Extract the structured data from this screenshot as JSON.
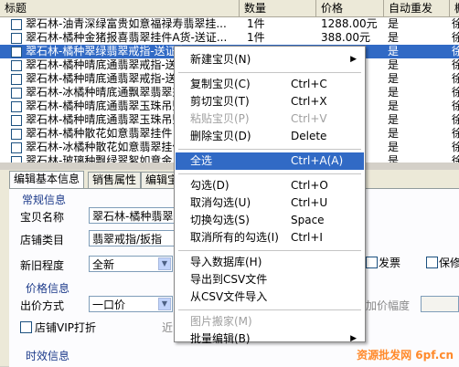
{
  "table": {
    "columns": [
      "标题",
      "数量",
      "价格",
      "自动重发",
      "橱"
    ],
    "rows": [
      {
        "title": "翠石林-油青深绿富贵如意福禄寿翡翠挂...",
        "qty": "1件",
        "price": "1288.00元",
        "auto": "是",
        "extra": "徐"
      },
      {
        "title": "翠石林-橘种金猪报喜翡翠挂件A货-送证...",
        "qty": "1件",
        "price": "388.00元",
        "auto": "是",
        "extra": "徐"
      },
      {
        "title": "翠石林-橘种翠绿翡翠戒指-送证书",
        "qty": "",
        "price": "",
        "auto": "是",
        "extra": "徐"
      },
      {
        "title": "翠石林-橘种晴底通翡翠戒指-送证书",
        "qty": "",
        "price": "",
        "auto": "是",
        "extra": "徐"
      },
      {
        "title": "翠石林-橘种晴底通翡翠戒指-送证书",
        "qty": "",
        "price": "",
        "auto": "是",
        "extra": "徐"
      },
      {
        "title": "翠石林-冰橘种晴底通飘翠翡翠戒指",
        "qty": "",
        "price": "",
        "auto": "是",
        "extra": "徐"
      },
      {
        "title": "翠石林-橘种晴底通翡翠玉珠吊坠",
        "qty": "",
        "price": "",
        "auto": "是",
        "extra": "徐"
      },
      {
        "title": "翠石林-橘种晴底通翡翠玉珠吊坠",
        "qty": "",
        "price": "",
        "auto": "是",
        "extra": "徐"
      },
      {
        "title": "翠石林-橘种散花如意翡翠挂件",
        "qty": "",
        "price": "",
        "auto": "是",
        "extra": "徐"
      },
      {
        "title": "翠石林-冰橘种散花如意翡翠挂件",
        "qty": "",
        "price": "",
        "auto": "是",
        "extra": "徐"
      },
      {
        "title": "翠石林-玻璃种飘绿翠絮如意金...",
        "qty": "",
        "price": "",
        "auto": "是",
        "extra": "徐"
      }
    ]
  },
  "tabs": [
    "编辑基本信息",
    "销售属性",
    "编辑宝"
  ],
  "form": {
    "group_general": "常规信息",
    "name_label": "宝贝名称",
    "name_value": "翠石林-橘种翡翠",
    "category_label": "店铺类目",
    "category_value": "翡翠戒指/扳指",
    "condition_label": "新旧程度",
    "condition_value": "全新",
    "group_price": "价格信息",
    "price_method_label": "出价方式",
    "price_method_value": "一口价",
    "vip_label": "店铺VIP打折",
    "group_time": "时效信息",
    "invoice_label": "发票",
    "warranty_label": "保修",
    "increment_label": "加价幅度",
    "truncated_left": "近"
  },
  "menu": {
    "items": [
      {
        "label": "新建宝贝(N)",
        "shortcut": "",
        "submenu": true
      },
      {
        "label": "复制宝贝(C)",
        "shortcut": "Ctrl+C"
      },
      {
        "label": "剪切宝贝(T)",
        "shortcut": "Ctrl+X"
      },
      {
        "label": "粘贴宝贝(P)",
        "shortcut": "Ctrl+V",
        "disabled": true
      },
      {
        "label": "删除宝贝(D)",
        "shortcut": "Delete"
      },
      {
        "label": "全选",
        "shortcut": "Ctrl+A(A)",
        "highlighted": true
      },
      {
        "label": "勾选(D)",
        "shortcut": "Ctrl+O"
      },
      {
        "label": "取消勾选(U)",
        "shortcut": "Ctrl+U"
      },
      {
        "label": "切换勾选(S)",
        "shortcut": "Space"
      },
      {
        "label": "取消所有的勾选(I)",
        "shortcut": "Ctrl+I"
      },
      {
        "label": "导入数据库(H)",
        "shortcut": ""
      },
      {
        "label": "导出到CSV文件",
        "shortcut": ""
      },
      {
        "label": "从CSV文件导入",
        "shortcut": ""
      },
      {
        "label": "图片搬家(M)",
        "shortcut": "",
        "disabled": true
      },
      {
        "label": "批量编辑(B)",
        "shortcut": "",
        "submenu": true
      }
    ]
  },
  "watermark": "资源批发网 6pf.cn",
  "colors": {
    "selection": "#316ac5",
    "group_title": "#1c3a8a",
    "watermark": "#ff8a2b"
  }
}
